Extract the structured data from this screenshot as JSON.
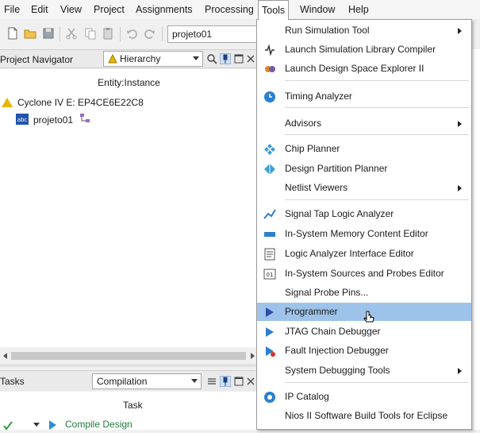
{
  "menubar": {
    "items": [
      "File",
      "Edit",
      "View",
      "Project",
      "Assignments",
      "Processing",
      "Tools",
      "Window",
      "Help"
    ],
    "open_item": "Tools"
  },
  "toolbar": {
    "project_combo": "projeto01"
  },
  "navigator": {
    "title": "Project Navigator",
    "view_combo": "Hierarchy",
    "column_header": "Entity:Instance",
    "device": "Cyclone IV E: EP4CE6E22C8",
    "top_entity": "projeto01"
  },
  "tasks": {
    "title": "Tasks",
    "flow_combo": "Compilation",
    "column_header": "Task",
    "first_task": "Compile Design"
  },
  "tools_menu": {
    "items": [
      {
        "label": "Run Simulation Tool",
        "icon": "none",
        "submenu": true
      },
      {
        "label": "Launch Simulation Library Compiler",
        "icon": "sim-lib-compiler-icon",
        "submenu": false
      },
      {
        "label": "Launch Design Space Explorer II",
        "icon": "dse-icon",
        "submenu": false
      },
      {
        "label": "Timing Analyzer",
        "icon": "timing-analyzer-icon",
        "submenu": false
      },
      {
        "label": "Advisors",
        "icon": "none",
        "submenu": true
      },
      {
        "label": "Chip Planner",
        "icon": "chip-planner-icon",
        "submenu": false
      },
      {
        "label": "Design Partition Planner",
        "icon": "partition-planner-icon",
        "submenu": false
      },
      {
        "label": "Netlist Viewers",
        "icon": "none",
        "submenu": true
      },
      {
        "label": "Signal Tap Logic Analyzer",
        "icon": "signal-tap-icon",
        "submenu": false
      },
      {
        "label": "In-System Memory Content Editor",
        "icon": "memory-editor-icon",
        "submenu": false
      },
      {
        "label": "Logic Analyzer Interface Editor",
        "icon": "lai-editor-icon",
        "submenu": false
      },
      {
        "label": "In-System Sources and Probes Editor",
        "icon": "sources-probes-icon",
        "submenu": false
      },
      {
        "label": "Signal Probe Pins...",
        "icon": "none",
        "submenu": false
      },
      {
        "label": "Programmer",
        "icon": "programmer-icon",
        "submenu": false,
        "highlighted": true
      },
      {
        "label": "JTAG Chain Debugger",
        "icon": "jtag-icon",
        "submenu": false
      },
      {
        "label": "Fault Injection Debugger",
        "icon": "fault-injection-icon",
        "submenu": false
      },
      {
        "label": "System Debugging Tools",
        "icon": "none",
        "submenu": true
      },
      {
        "label": "IP Catalog",
        "icon": "ip-catalog-icon",
        "submenu": false
      },
      {
        "label": "Nios II Software Build Tools for Eclipse",
        "icon": "none",
        "submenu": false
      }
    ]
  },
  "colors": {
    "highlight": "#9ec3ea",
    "task_link": "#1f7a3a",
    "device_warning": "#e8b400"
  }
}
